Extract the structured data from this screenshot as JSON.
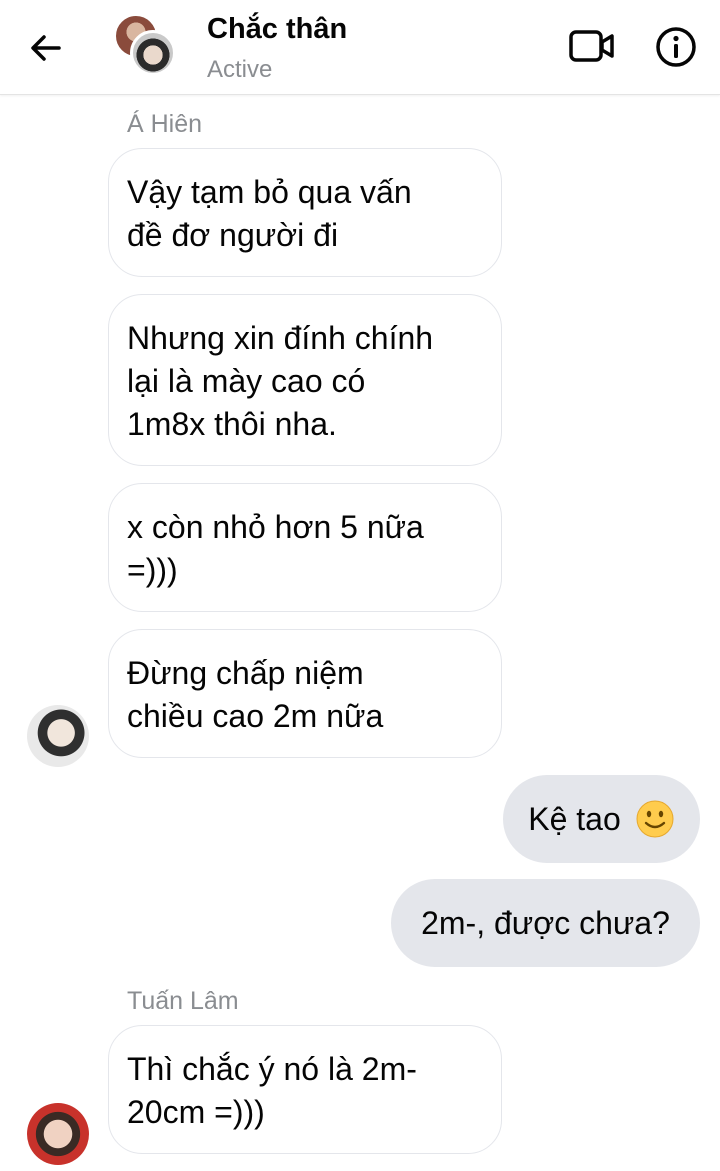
{
  "header": {
    "title": "Chắc thân",
    "status": "Active"
  },
  "icons": {
    "back": "arrow-left-icon",
    "video": "video-camera-icon",
    "info": "info-circle-icon"
  },
  "colors": {
    "incoming_bubble_border": "#e4e6eb",
    "outgoing_bubble_bg": "#e4e6eb",
    "secondary_text": "#8a8d91"
  },
  "messages": {
    "sender1": "Á Hiên",
    "m1": [
      "Vậy tạm bỏ qua vấn",
      "đề đơ người đi"
    ],
    "m2": [
      "Nhưng xin đính chính",
      "lại là mày cao có",
      "1m8x thôi nha."
    ],
    "m3": [
      "x còn nhỏ hơn 5 nữa",
      "=)))"
    ],
    "m4": [
      "Đừng chấp niệm",
      "chiều cao 2m nữa"
    ],
    "out1": "Kệ tao",
    "out1_emoji": "slightly-smiling-face",
    "out2": "2m-, được chưa?",
    "sender2": "Tuấn Lâm",
    "m5": [
      "Thì chắc ý nó là 2m-",
      "20cm =)))"
    ]
  }
}
